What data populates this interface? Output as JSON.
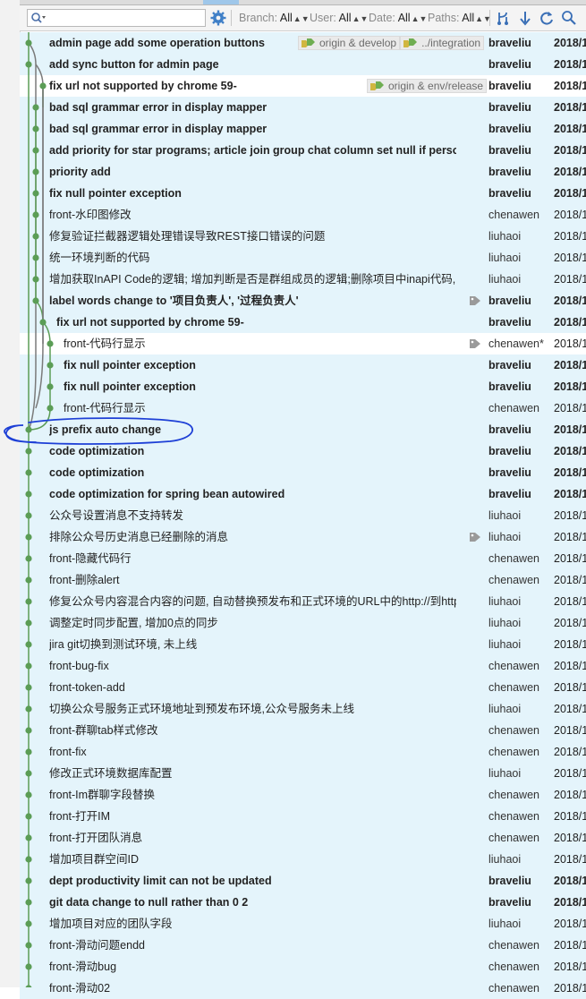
{
  "toolbar": {
    "search_placeholder": "",
    "filters": [
      {
        "label": "Branch:",
        "value": "All"
      },
      {
        "label": "User:",
        "value": "All"
      },
      {
        "label": "Date:",
        "value": "All"
      },
      {
        "label": "Paths:",
        "value": "All"
      }
    ],
    "icons": [
      "search-icon",
      "settings-icon",
      "branch-graph-icon",
      "sort-down-icon",
      "refresh-icon",
      "find-icon"
    ]
  },
  "colors": {
    "graph_green": "#5b9d56",
    "graph_gray": "#7a7a7a",
    "row_highlight": "#e4f4fb",
    "ref_badge_bg": "#eaeaea",
    "annotation_blue": "#1d3fd6"
  },
  "commits": [
    {
      "message": "admin page add some operation buttons",
      "bold": true,
      "author": "braveliu",
      "date": "2018/1",
      "refs": [
        "origin & develop",
        "../integration"
      ]
    },
    {
      "message": "add sync button for admin page",
      "bold": true,
      "author": "braveliu",
      "date": "2018/1"
    },
    {
      "message": "fix url not supported by chrome 59-",
      "bold": true,
      "author": "braveliu",
      "date": "2018/1",
      "refs": [
        "origin & env/release"
      ]
    },
    {
      "message": "bad sql grammar error in display mapper",
      "bold": true,
      "author": "braveliu",
      "date": "2018/1"
    },
    {
      "message": "bad sql grammar error in display mapper",
      "bold": true,
      "author": "braveliu",
      "date": "2018/1"
    },
    {
      "message": "add priority for star programs; article join group chat column set null if person",
      "bold": true,
      "author": "braveliu",
      "date": "2018/1"
    },
    {
      "message": "priority add",
      "bold": true,
      "author": "braveliu",
      "date": "2018/1"
    },
    {
      "message": "fix null pointer exception",
      "bold": true,
      "author": "braveliu",
      "date": "2018/1"
    },
    {
      "message": "front-水印图修改",
      "bold": false,
      "author": "chenawen",
      "date": "2018/1"
    },
    {
      "message": "修复验证拦截器逻辑处理错误导致REST接口错误的问题",
      "bold": false,
      "author": "liuhaoi",
      "date": "2018/1"
    },
    {
      "message": "统一环境判断的代码",
      "bold": false,
      "author": "liuhaoi",
      "date": "2018/1"
    },
    {
      "message": "增加获取InAPI Code的逻辑; 增加判断是否是群组成员的逻辑;删除项目中inapi代码, 更改为依",
      "bold": false,
      "author": "liuhaoi",
      "date": "2018/1"
    },
    {
      "message": "label words change to '项目负责人', '过程负责人'",
      "bold": true,
      "author": "braveliu",
      "date": "2018/1",
      "tag": true
    },
    {
      "message": "fix url not supported by chrome 59-",
      "bold": true,
      "author": "braveliu",
      "date": "2018/1"
    },
    {
      "message": "front-代码行显示",
      "bold": false,
      "author": "chenawen*",
      "date": "2018/1",
      "tag": true
    },
    {
      "message": "fix null pointer exception",
      "bold": true,
      "author": "braveliu",
      "date": "2018/1"
    },
    {
      "message": "fix null pointer exception",
      "bold": true,
      "author": "braveliu",
      "date": "2018/1"
    },
    {
      "message": "front-代码行显示",
      "bold": false,
      "author": "chenawen",
      "date": "2018/1"
    },
    {
      "message": "js prefix auto change",
      "bold": true,
      "author": "braveliu",
      "date": "2018/1"
    },
    {
      "message": "code optimization",
      "bold": true,
      "author": "braveliu",
      "date": "2018/1"
    },
    {
      "message": "code optimization",
      "bold": true,
      "author": "braveliu",
      "date": "2018/1"
    },
    {
      "message": "code optimization for spring bean autowired",
      "bold": true,
      "author": "braveliu",
      "date": "2018/1"
    },
    {
      "message": "公众号设置消息不支持转发",
      "bold": false,
      "author": "liuhaoi",
      "date": "2018/1"
    },
    {
      "message": "排除公众号历史消息已经删除的消息",
      "bold": false,
      "author": "liuhaoi",
      "date": "2018/1",
      "tag": true
    },
    {
      "message": "front-隐藏代码行",
      "bold": false,
      "author": "chenawen",
      "date": "2018/1"
    },
    {
      "message": "front-删除alert",
      "bold": false,
      "author": "chenawen",
      "date": "2018/1"
    },
    {
      "message": "修复公众号内容混合内容的问题, 自动替换预发布和正式环境的URL中的http://到https://",
      "bold": false,
      "author": "liuhaoi",
      "date": "2018/1"
    },
    {
      "message": "调整定时同步配置, 增加0点的同步",
      "bold": false,
      "author": "liuhaoi",
      "date": "2018/1"
    },
    {
      "message": "jira git切换到测试环境, 未上线",
      "bold": false,
      "author": "liuhaoi",
      "date": "2018/1"
    },
    {
      "message": "front-bug-fix",
      "bold": false,
      "author": "chenawen",
      "date": "2018/1"
    },
    {
      "message": "front-token-add",
      "bold": false,
      "author": "chenawen",
      "date": "2018/1"
    },
    {
      "message": "切换公众号服务正式环境地址到预发布环境,公众号服务未上线",
      "bold": false,
      "author": "liuhaoi",
      "date": "2018/1"
    },
    {
      "message": "front-群聊tab样式修改",
      "bold": false,
      "author": "chenawen",
      "date": "2018/1"
    },
    {
      "message": "front-fix",
      "bold": false,
      "author": "chenawen",
      "date": "2018/1"
    },
    {
      "message": "修改正式环境数据库配置",
      "bold": false,
      "author": "liuhaoi",
      "date": "2018/1"
    },
    {
      "message": "front-Im群聊字段替换",
      "bold": false,
      "author": "chenawen",
      "date": "2018/1"
    },
    {
      "message": "front-打开IM",
      "bold": false,
      "author": "chenawen",
      "date": "2018/1"
    },
    {
      "message": "front-打开团队消息",
      "bold": false,
      "author": "chenawen",
      "date": "2018/1"
    },
    {
      "message": "增加项目群空间ID",
      "bold": false,
      "author": "liuhaoi",
      "date": "2018/1"
    },
    {
      "message": "dept productivity limit can not be updated",
      "bold": true,
      "author": "braveliu",
      "date": "2018/1"
    },
    {
      "message": "git data change to null rather than 0 2",
      "bold": true,
      "author": "braveliu",
      "date": "2018/1"
    },
    {
      "message": "增加项目对应的团队字段",
      "bold": false,
      "author": "liuhaoi",
      "date": "2018/1"
    },
    {
      "message": "front-滑动问题endd",
      "bold": false,
      "author": "chenawen",
      "date": "2018/1"
    },
    {
      "message": "front-滑动bug",
      "bold": false,
      "author": "chenawen",
      "date": "2018/1"
    },
    {
      "message": "front-滑动02",
      "bold": false,
      "author": "chenawen",
      "date": "2018/1"
    }
  ]
}
